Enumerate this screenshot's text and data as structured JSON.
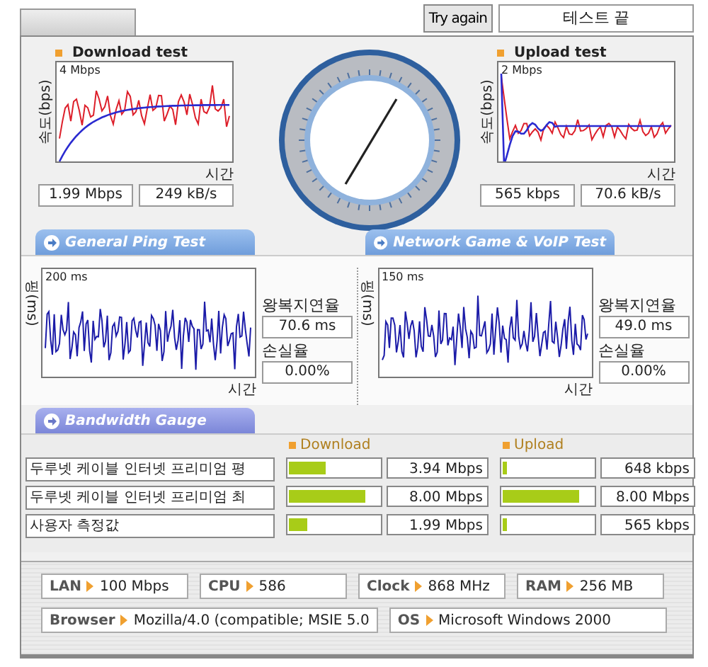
{
  "header": {
    "button": "Try again",
    "status": "테스트 끝"
  },
  "throughput": [
    {
      "kind": "download",
      "title": "Download test",
      "axis_label": "속도(bps)",
      "scale": "4 Mbps",
      "time_label": "시간",
      "rate": "1.99 Mbps",
      "bytes": "249 kB/s"
    },
    {
      "kind": "upload",
      "title": "Upload test",
      "axis_label": "속도(bps)",
      "scale": "2 Mbps",
      "time_label": "시간",
      "rate": "565 kbps",
      "bytes": "70.6 kB/s"
    }
  ],
  "ping_tests": [
    {
      "tab": "General Ping Test",
      "axis_label": "핑(ms)",
      "scale": "200 ms",
      "time_label": "시간",
      "latency_label": "왕복지연율",
      "latency": "70.6 ms",
      "loss_label": "손실율",
      "loss": "0.00%"
    },
    {
      "tab": "Network Game & VoIP Test",
      "axis_label": "핑(ms)",
      "scale": "150 ms",
      "time_label": "시간",
      "latency_label": "왕복지연율",
      "latency": "49.0 ms",
      "loss_label": "손실율",
      "loss": "0.00%"
    }
  ],
  "bandwidth": {
    "tab": "Bandwidth Gauge",
    "columns": [
      "Download",
      "Upload"
    ],
    "rows": [
      {
        "name": "두루넷 케이블 인터넷 프리미엄 평",
        "download": {
          "level": 0.4,
          "reading": "3.94 Mbps"
        },
        "upload": {
          "level": 0.04,
          "reading": "648 kbps"
        }
      },
      {
        "name": "두루넷 케이블 인터넷 프리미엄 최",
        "download": {
          "level": 0.84,
          "reading": "8.00 Mbps"
        },
        "upload": {
          "level": 0.84,
          "reading": "8.00 Mbps"
        }
      },
      {
        "name": "사용자 측정값",
        "download": {
          "level": 0.2,
          "reading": "1.99 Mbps"
        },
        "upload": {
          "level": 0.04,
          "reading": "565 kbps"
        }
      }
    ]
  },
  "system": [
    [
      {
        "label": "LAN",
        "value": "100 Mbps"
      },
      {
        "label": "CPU",
        "value": "586"
      },
      {
        "label": "Clock",
        "value": "868 MHz"
      },
      {
        "label": "RAM",
        "value": "256 MB"
      }
    ],
    [
      {
        "label": "Browser",
        "value": "Mozilla/4.0 (compatible; MSIE 5.0"
      },
      {
        "label": "OS",
        "value": "Microsoft Windows 2000"
      }
    ]
  ]
}
